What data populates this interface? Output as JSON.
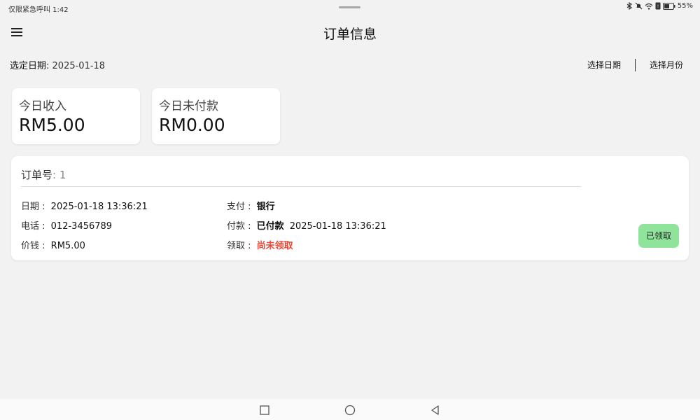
{
  "status_bar": {
    "left_text": "仅限紧急呼叫 1:42",
    "battery": "55%"
  },
  "app_bar": {
    "title": "订单信息",
    "menu_icon": "hamburger-menu-icon"
  },
  "date_bar": {
    "label": "选定日期",
    "separator": ": ",
    "value": "2025-01-18",
    "select_date": "选择日期",
    "select_month": "选择月份"
  },
  "stats": {
    "income": {
      "label": "今日收入",
      "value": "RM5.00"
    },
    "unpaid": {
      "label": "今日未付款",
      "value": "RM0.00"
    }
  },
  "order": {
    "header_label": "订单号",
    "header_sep": ": ",
    "number": "1",
    "date": {
      "label": "日期",
      "sep": " : ",
      "value": "2025-01-18 13:36:21"
    },
    "phone": {
      "label": "电话",
      "sep": " : ",
      "value": "012-3456789"
    },
    "price": {
      "label": "价钱",
      "sep": " : ",
      "value": "RM5.00"
    },
    "payment": {
      "label": "支付",
      "sep": " : ",
      "value": "银行"
    },
    "paid": {
      "label": "付款",
      "sep": " : ",
      "status": "已付款",
      "time": "2025-01-18 13:36:21"
    },
    "collect": {
      "label": "领取",
      "sep": " : ",
      "status": "尚未领取"
    },
    "collect_button": "已领取"
  },
  "colors": {
    "accent_green": "#8fe39b",
    "warning_red": "#e54a38",
    "background": "#f2f2f2"
  },
  "nav_bar": {
    "icons": [
      "recent-apps-icon",
      "home-icon",
      "back-icon"
    ]
  }
}
